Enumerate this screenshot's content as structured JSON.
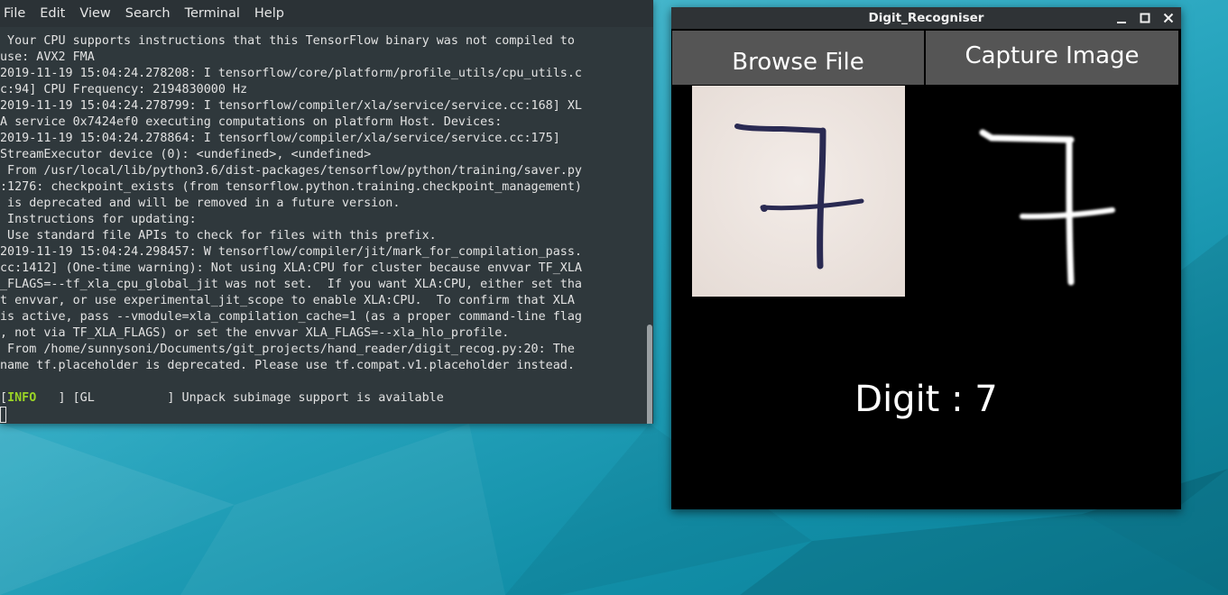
{
  "terminal": {
    "menu": [
      "File",
      "Edit",
      "View",
      "Search",
      "Terminal",
      "Help"
    ],
    "lines": [
      " Your CPU supports instructions that this TensorFlow binary was not compiled to",
      "use: AVX2 FMA",
      "2019-11-19 15:04:24.278208: I tensorflow/core/platform/profile_utils/cpu_utils.c",
      "c:94] CPU Frequency: 2194830000 Hz",
      "2019-11-19 15:04:24.278799: I tensorflow/compiler/xla/service/service.cc:168] XL",
      "A service 0x7424ef0 executing computations on platform Host. Devices:",
      "2019-11-19 15:04:24.278864: I tensorflow/compiler/xla/service/service.cc:175]",
      "StreamExecutor device (0): <undefined>, <undefined>",
      " From /usr/local/lib/python3.6/dist-packages/tensorflow/python/training/saver.py",
      ":1276: checkpoint_exists (from tensorflow.python.training.checkpoint_management)",
      " is deprecated and will be removed in a future version.",
      " Instructions for updating:",
      " Use standard file APIs to check for files with this prefix.",
      "2019-11-19 15:04:24.298457: W tensorflow/compiler/jit/mark_for_compilation_pass.",
      "cc:1412] (One-time warning): Not using XLA:CPU for cluster because envvar TF_XLA",
      "_FLAGS=--tf_xla_cpu_global_jit was not set.  If you want XLA:CPU, either set tha",
      "t envvar, or use experimental_jit_scope to enable XLA:CPU.  To confirm that XLA",
      "is active, pass --vmodule=xla_compilation_cache=1 (as a proper command-line flag",
      ", not via TF_XLA_FLAGS) or set the envvar XLA_FLAGS=--xla_hlo_profile.",
      " From /home/sunnysoni/Documents/git_projects/hand_reader/digit_recog.py:20: The",
      "name tf.placeholder is deprecated. Please use tf.compat.v1.placeholder instead.",
      ""
    ],
    "info_prefix": "[",
    "info_tag": "INFO",
    "info_rest": "   ] [GL          ] Unpack subimage support is available"
  },
  "app": {
    "title": "Digit_Recogniser",
    "browse_label": "Browse File",
    "capture_label": "Capture Image",
    "result_text": "Digit : 7"
  },
  "colors": {
    "terminal_bg": "#2f383c",
    "info_green": "#9ad326",
    "button_gray": "#555555",
    "app_bg": "#000000"
  }
}
